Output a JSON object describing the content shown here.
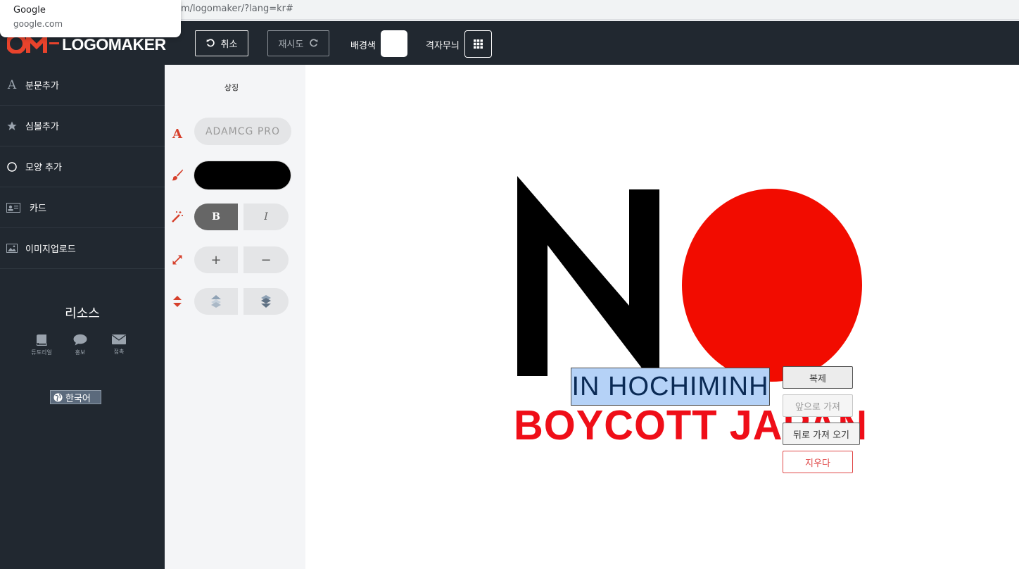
{
  "browser": {
    "url_fragment": "m/logomaker/?lang=kr#",
    "suggestion": {
      "title": "Google",
      "domain": "google.com"
    }
  },
  "app": {
    "logo_word": "LOGOMAKER",
    "undo_label": "취소",
    "redo_label": "재시도",
    "bg_color_label": "배경색",
    "grid_label": "격자무늬"
  },
  "sidebar": {
    "items": [
      {
        "label": "분문추가",
        "icon": "text-icon"
      },
      {
        "label": "심볼추가",
        "icon": "star-icon"
      },
      {
        "label": "모양 추가",
        "icon": "circle-icon"
      },
      {
        "label": "카드",
        "icon": "card-icon"
      },
      {
        "label": "이미지업로드",
        "icon": "image-icon"
      }
    ],
    "resources_title": "리소스",
    "resources": [
      {
        "label": "튜토리얼",
        "icon": "book-icon"
      },
      {
        "label": "홍보",
        "icon": "chat-icon"
      },
      {
        "label": "접촉",
        "icon": "mail-icon"
      }
    ],
    "language": "한국어"
  },
  "panel": {
    "title": "상징",
    "font_name": "ADAMCG PRO",
    "text_color": "#000000",
    "bold_label": "B",
    "italic_label": "I",
    "size_up_label": "+",
    "size_down_label": "−"
  },
  "canvas": {
    "background": "#ffffff",
    "shapes": {
      "letter": "N",
      "circle_color": "#f20c00"
    },
    "selected_text": "IN HOCHIMINH",
    "headline": "BOYCOTT JAPAN",
    "headline_color": "#ef0e18"
  },
  "context_menu": {
    "duplicate": "복제",
    "bring_forward": "앞으로 가져",
    "send_backward": "뒤로 가져 오기",
    "delete": "지우다"
  }
}
